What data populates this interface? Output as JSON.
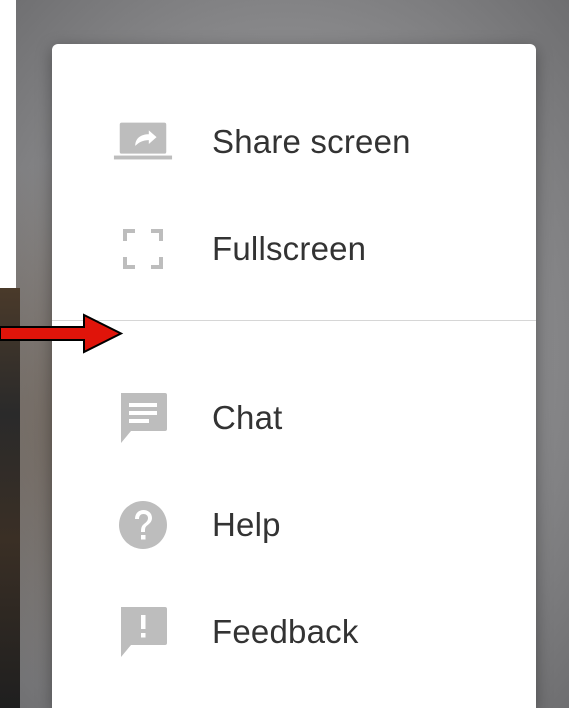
{
  "menu": {
    "items": [
      {
        "label": "Share screen",
        "icon": "share-screen-icon"
      },
      {
        "label": "Fullscreen",
        "icon": "fullscreen-icon"
      },
      {
        "label": "Chat",
        "icon": "chat-icon"
      },
      {
        "label": "Help",
        "icon": "help-icon"
      },
      {
        "label": "Feedback",
        "icon": "feedback-icon"
      }
    ]
  },
  "annotation": {
    "icon": "red-arrow-icon",
    "color": "#e0140a"
  },
  "colors": {
    "icon_gray": "#bdbdbd",
    "text": "#333333",
    "divider": "#d6d6d6"
  }
}
